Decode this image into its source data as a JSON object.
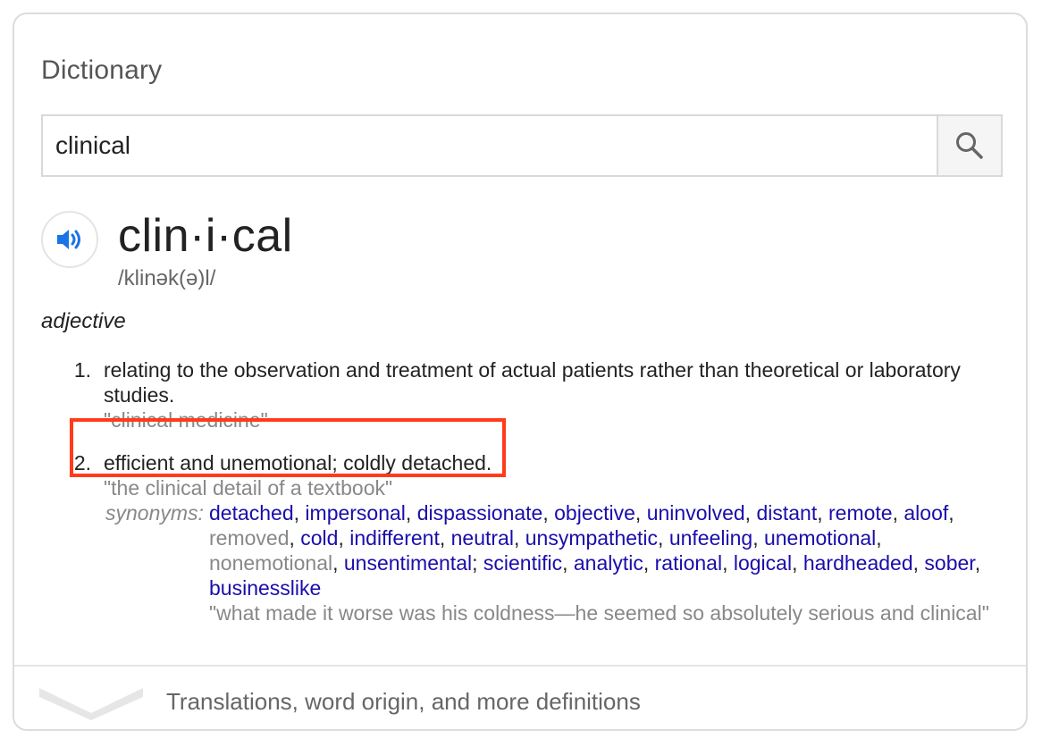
{
  "card": {
    "title": "Dictionary"
  },
  "search": {
    "value": "clinical",
    "icon": "search-icon"
  },
  "entry": {
    "speaker_icon": "speaker-icon",
    "headword": "clin·i·cal",
    "phonetic": "/klinək(ə)l/",
    "part_of_speech": "adjective",
    "senses": [
      {
        "number": "1.",
        "definition_line1": "relating to the observation and treatment of actual patients rather than theoretical or laboratory",
        "definition_line2": "studies.",
        "example": "\"clinical medicine\""
      },
      {
        "number": "2.",
        "definition": "efficient and unemotional; coldly detached.",
        "example": "\"the clinical detail of a textbook\"",
        "synonyms_label": "synonyms:",
        "synonyms": [
          "detached",
          "impersonal",
          "dispassionate",
          "objective",
          "uninvolved",
          "distant",
          "remote",
          "aloof",
          "removed",
          "cold",
          "indifferent",
          "neutral",
          "unsympathetic",
          "unfeeling",
          "unemotional",
          "nonemotional",
          "unsentimental",
          "scientific",
          "analytic",
          "rational",
          "logical",
          "hardheaded",
          "sober",
          "businesslike"
        ],
        "synonym_example": "\"what made it worse was his coldness—he seemed so absolutely serious and clinical\""
      }
    ]
  },
  "footer": {
    "more_label": "Translations, word origin, and more definitions",
    "chevron_icon": "chevron-down-icon"
  },
  "colors": {
    "link": "#1a0dab",
    "muted": "#888888",
    "highlight": "#ff3b1a",
    "border": "#dadce0",
    "speaker": "#1a73e8"
  }
}
